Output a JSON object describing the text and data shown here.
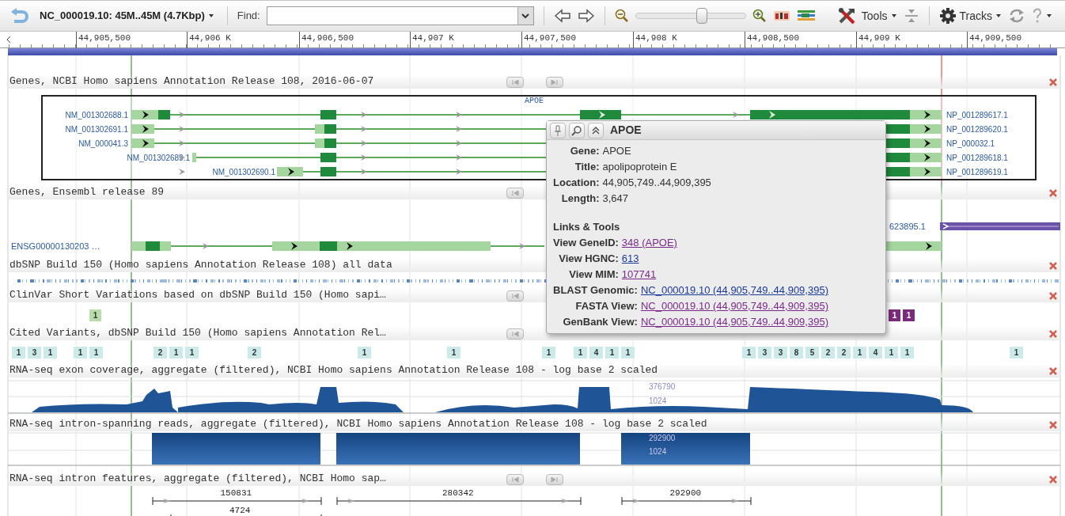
{
  "toolbar": {
    "location": "NC_000019.10: 45M..45M (4.7Kbp)",
    "find_label": "Find:",
    "zoom_slider": {
      "level": 0.6
    },
    "tools": "Tools",
    "tracks": "Tracks"
  },
  "ruler": {
    "ticks": [
      "44,905,500",
      "44,906 K",
      "44,906,500",
      "44,907 K",
      "44,907,500",
      "44,908 K",
      "44,908,500",
      "44,909 K",
      "44,909,500"
    ]
  },
  "tracks": [
    {
      "kind": "genes",
      "title": "Genes, NCBI Homo sapiens Annotation Release 108, 2016-06-07",
      "gene_label": "APOE",
      "transcripts": [
        {
          "name": "NM_001302688.1",
          "protein": "NP_001289617.1"
        },
        {
          "name": "NM_001302691.1",
          "protein": "NP_001289620.1"
        },
        {
          "name": "NM_000041.3",
          "protein": "NP_000032.1"
        },
        {
          "name": "NM_001302689.1",
          "protein": "NP_001289618.1"
        },
        {
          "name": "NM_001302690.1",
          "protein": "NP_001289619.1"
        }
      ]
    },
    {
      "kind": "ensembl",
      "title": "Genes, Ensembl release 89",
      "features": [
        "623895.1",
        "ENSG00000130203 …"
      ]
    },
    {
      "kind": "snp",
      "title": "dbSNP Build 150 (Homo sapiens Annotation Release 108) all data"
    },
    {
      "kind": "clinvar",
      "title": "ClinVar Short Variations based on dbSNP Build 150 (Homo sapi…",
      "badges": [
        {
          "label": "1",
          "color": "#b9dcab"
        },
        {
          "label": "1",
          "color": "#7b2b7b"
        },
        {
          "label": "1",
          "color": "#7b2b7b"
        }
      ]
    },
    {
      "kind": "cited",
      "title": "Cited Variants, dbSNP Build 150 (Homo sapiens Annotation Rel…",
      "groups": [
        [
          "1",
          "3",
          "1"
        ],
        [
          "1",
          "1"
        ],
        [
          "2",
          "1",
          "1"
        ],
        [
          "2"
        ],
        [
          "1"
        ],
        [
          "1"
        ],
        [
          "1"
        ],
        [
          "1",
          "4",
          "1",
          "1"
        ],
        [
          "1",
          "3",
          "3",
          "8",
          "5",
          "2",
          "2",
          "1",
          "4",
          "1",
          "1"
        ],
        [
          "1"
        ]
      ]
    },
    {
      "kind": "coverage",
      "title": "RNA-seq exon coverage, aggregate (filtered), NCBI Homo sapiens Annotation Release 108 - log base 2 scaled",
      "scale": [
        "376790",
        "1024"
      ]
    },
    {
      "kind": "spanning",
      "title": "RNA-seq intron-spanning reads, aggregate (filtered), NCBI Homo sapiens Annotation Release 108 - log base 2 scaled",
      "scale": [
        "292900",
        "1024"
      ]
    },
    {
      "kind": "introns",
      "title": "RNA-seq intron features, aggregate (filtered), NCBI Homo sap…",
      "features": [
        "150831",
        "280342",
        "292900",
        "4724"
      ]
    }
  ],
  "popup": {
    "title": "APOE",
    "fields": [
      {
        "label": "Gene:",
        "value": "APOE"
      },
      {
        "label": "Title:",
        "value": "apolipoprotein E"
      },
      {
        "label": "Location:",
        "value": "44,905,749..44,909,395"
      },
      {
        "label": "Length:",
        "value": "3,647"
      }
    ],
    "section": "Links & Tools",
    "links": [
      {
        "label": "View GeneID:",
        "value": "348 (APOE)",
        "visited": true
      },
      {
        "label": "View HGNC:",
        "value": "613",
        "visited": false
      },
      {
        "label": "View MIM:",
        "value": "107741",
        "visited": true
      }
    ],
    "tools": [
      {
        "label": "BLAST Genomic:",
        "value": "NC_000019.10 (44,905,749..44,909,395)",
        "visited": false
      },
      {
        "label": "FASTA View:",
        "value": "NC_000019.10 (44,905,749..44,909,395)",
        "visited": true
      },
      {
        "label": "GenBank View:",
        "value": "NC_000019.10 (44,905,749..44,909,395)",
        "visited": true
      }
    ]
  }
}
